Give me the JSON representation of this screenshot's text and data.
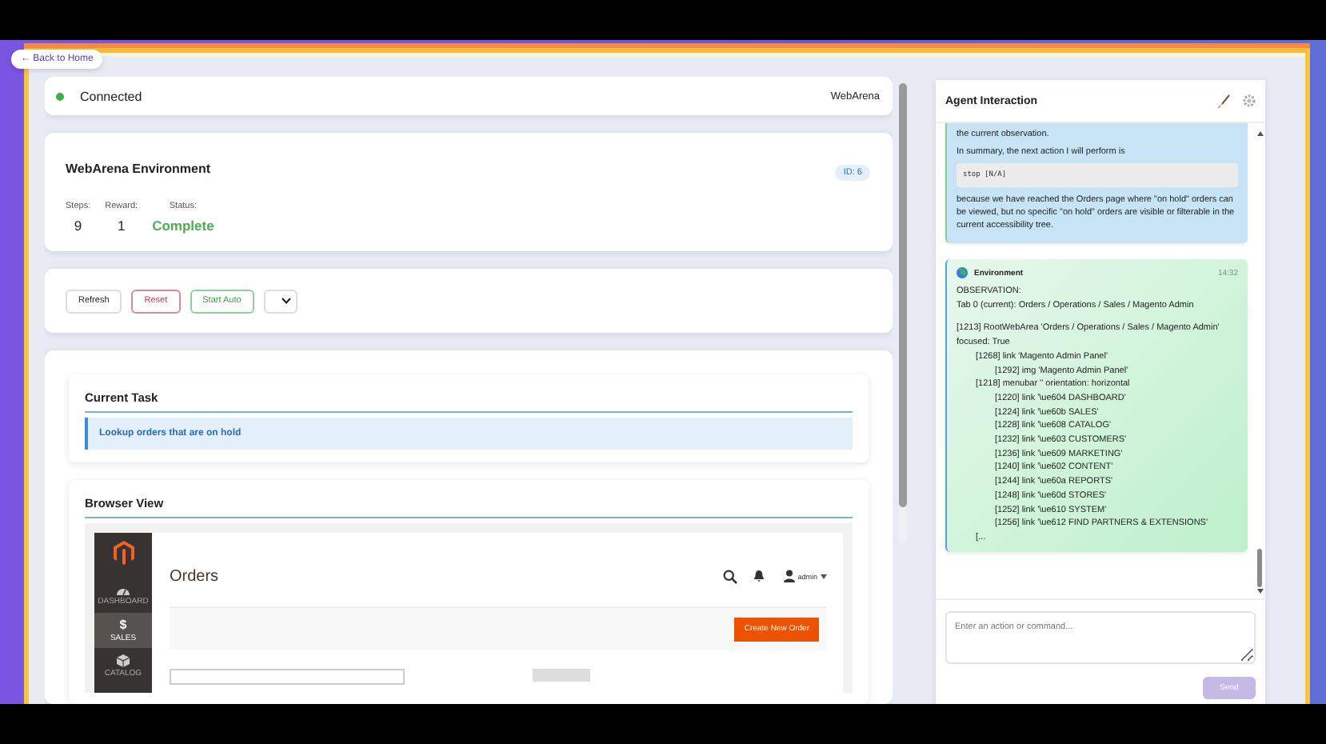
{
  "back_link": {
    "label": "← Back to Home"
  },
  "connection": {
    "label": "Connected",
    "connected": true,
    "environment": "WebArena"
  },
  "environment_card": {
    "title": "WebArena Environment",
    "id_badge": "ID: 6",
    "stats": [
      {
        "label": "Steps:",
        "value": "9",
        "kind": "plain"
      },
      {
        "label": "Reward:",
        "value": "1",
        "kind": "plain"
      },
      {
        "label": "Status:",
        "value": "Complete",
        "kind": "success"
      }
    ]
  },
  "controls": [
    {
      "label": "Refresh",
      "kind": "neutral"
    },
    {
      "label": "Reset",
      "kind": "danger"
    },
    {
      "label": "Start Auto",
      "kind": "success"
    },
    {
      "kind": "select"
    }
  ],
  "current_task": {
    "title": "Current Task",
    "text": "Lookup orders that are on hold"
  },
  "browser_view": {
    "title": "Browser View",
    "page": {
      "sidebar": [
        {
          "label": "DASHBOARD",
          "selected": false
        },
        {
          "glyph": "$",
          "label": "SALES",
          "selected": true
        },
        {
          "label": "CATALOG",
          "selected": false
        }
      ],
      "title": "Orders",
      "user": "admin",
      "primary_button": "Create New Order"
    }
  },
  "agent_panel": {
    "title": "Agent Interaction",
    "messages": [
      {
        "kind": "agent",
        "paragraphs": [
          "the current observation.",
          "In summary, the next action I will perform is"
        ],
        "code": "stop [N/A]",
        "tail": " because we have reached the Orders page where \"on hold\" orders can be viewed, but no specific \"on hold\" orders are visible or filterable in the current accessibility tree."
      },
      {
        "kind": "environment",
        "sender": "Environment",
        "time": "14:32",
        "header": [
          "OBSERVATION:",
          "Tab 0 (current): Orders / Operations / Sales / Magento Admin"
        ],
        "tree": [
          {
            "text": "[1213] RootWebArea 'Orders / Operations / Sales / Magento Admin' focused: True",
            "children": [
              {
                "text": "[1268] link 'Magento Admin Panel'",
                "children": [
                  {
                    "text": "[1292] img 'Magento Admin Panel'"
                  }
                ]
              },
              {
                "text": "[1218] menubar '' orientation: horizontal",
                "children": [
                  {
                    "text": "[1220] link '\\ue604 DASHBOARD'"
                  },
                  {
                    "text": "[1224] link '\\ue60b SALES'"
                  },
                  {
                    "text": "[1228] link '\\ue608 CATALOG'"
                  },
                  {
                    "text": "[1232] link '\\ue603 CUSTOMERS'"
                  },
                  {
                    "text": "[1236] link '\\ue609 MARKETING'"
                  },
                  {
                    "text": "[1240] link '\\ue602 CONTENT'"
                  },
                  {
                    "text": "[1244] link '\\ue60a REPORTS'"
                  },
                  {
                    "text": "[1248] link '\\ue60d STORES'"
                  },
                  {
                    "text": "[1252] link '\\ue610 SYSTEM'"
                  },
                  {
                    "text": "[1256] link '\\ue612 FIND PARTNERS & EXTENSIONS'"
                  }
                ]
              },
              {
                "text": "[..."
              }
            ]
          }
        ]
      }
    ],
    "input": {
      "placeholder": "Enter an action or command..."
    },
    "send_button": {
      "label": "Send",
      "disabled": true
    }
  }
}
